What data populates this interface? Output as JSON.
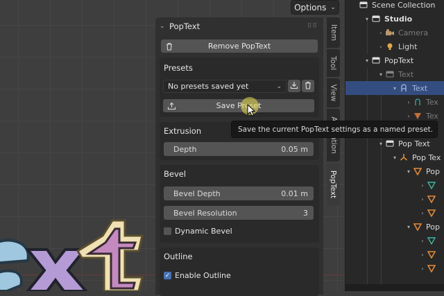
{
  "toolbar": {
    "options_label": "Options",
    "options_chevron": "chevron-down-icon"
  },
  "panel": {
    "title": "PopText",
    "remove_label": "Remove PopText",
    "presets": {
      "heading": "Presets",
      "selected": "No presets saved yet",
      "save_label": "Save Preset"
    },
    "extrusion": {
      "heading": "Extrusion",
      "depth_label": "Depth",
      "depth_value": "0.05 m"
    },
    "bevel": {
      "heading": "Bevel",
      "depth_label": "Bevel Depth",
      "depth_value": "0.01 m",
      "resolution_label": "Bevel Resolution",
      "resolution_value": "3",
      "dynamic_label": "Dynamic Bevel",
      "dynamic_checked": false
    },
    "outline": {
      "heading": "Outline",
      "enable_label": "Enable Outline",
      "enable_checked": true
    }
  },
  "tabs": [
    {
      "label": "Item",
      "active": false
    },
    {
      "label": "Tool",
      "active": false
    },
    {
      "label": "View",
      "active": false
    },
    {
      "label": "Animation",
      "active": false
    },
    {
      "label": "PopText",
      "active": true
    }
  ],
  "tooltip": {
    "text": "Save the current PopText settings as a named preset."
  },
  "outliner": {
    "rows": [
      {
        "label": "Scene Collection",
        "icon": "scene-collection-icon"
      },
      {
        "label": "Studio",
        "icon": "collection-icon"
      },
      {
        "label": "Camera",
        "icon": "camera-icon"
      },
      {
        "label": "Light",
        "icon": "light-icon"
      },
      {
        "label": "PopText",
        "icon": "collection-icon"
      },
      {
        "label": "Text",
        "icon": "collection-icon"
      },
      {
        "label": "Text",
        "icon": "text-object-icon"
      },
      {
        "label": "Tex",
        "icon": "text-data-icon"
      },
      {
        "label": "Tex",
        "icon": "modifier-icon"
      },
      {
        "label": "Pop Text",
        "icon": "collection-icon"
      },
      {
        "label": "Pop Tex",
        "icon": "empty-icon"
      },
      {
        "label": "Pop",
        "icon": "mesh-icon"
      },
      {
        "label": "Pop",
        "icon": "mesh-icon"
      }
    ]
  },
  "colors": {
    "accent": "#4772b3",
    "selection": "#334d80",
    "cursor_highlight": "#ebdc50"
  }
}
